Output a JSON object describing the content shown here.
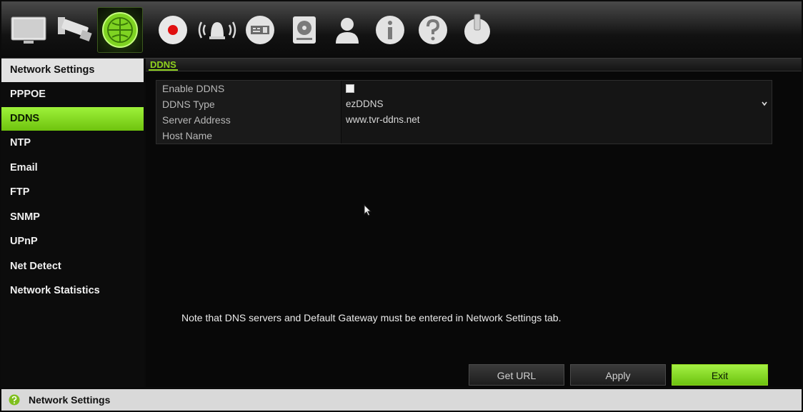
{
  "toolbar": {
    "icons": [
      "monitor-icon",
      "camera-icon",
      "network-icon",
      "record-icon",
      "alarm-icon",
      "device-icon",
      "storage-icon",
      "user-icon",
      "info-icon",
      "help-icon",
      "power-icon"
    ],
    "active": "network-icon"
  },
  "sidebar": {
    "items": [
      {
        "label": "Network Settings"
      },
      {
        "label": "PPPOE"
      },
      {
        "label": "DDNS",
        "selected": true
      },
      {
        "label": "NTP"
      },
      {
        "label": "Email"
      },
      {
        "label": "FTP"
      },
      {
        "label": "SNMP"
      },
      {
        "label": "UPnP"
      },
      {
        "label": "Net Detect"
      },
      {
        "label": "Network Statistics"
      }
    ]
  },
  "main": {
    "tab": "DDNS",
    "form": {
      "enable_ddns": {
        "label": "Enable DDNS",
        "checked": true
      },
      "ddns_type": {
        "label": "DDNS Type",
        "value": "ezDDNS"
      },
      "server_address": {
        "label": "Server Address",
        "value": "www.tvr-ddns.net"
      },
      "host_name": {
        "label": "Host Name",
        "value": ""
      }
    },
    "note": "Note that DNS servers and Default Gateway must be entered in Network Settings tab.",
    "buttons": {
      "get_url": "Get URL",
      "apply": "Apply",
      "exit": "Exit"
    }
  },
  "statusbar": {
    "text": "Network Settings"
  },
  "colors": {
    "accent_green": "#8fd11e",
    "background": "#0b0b0b"
  }
}
